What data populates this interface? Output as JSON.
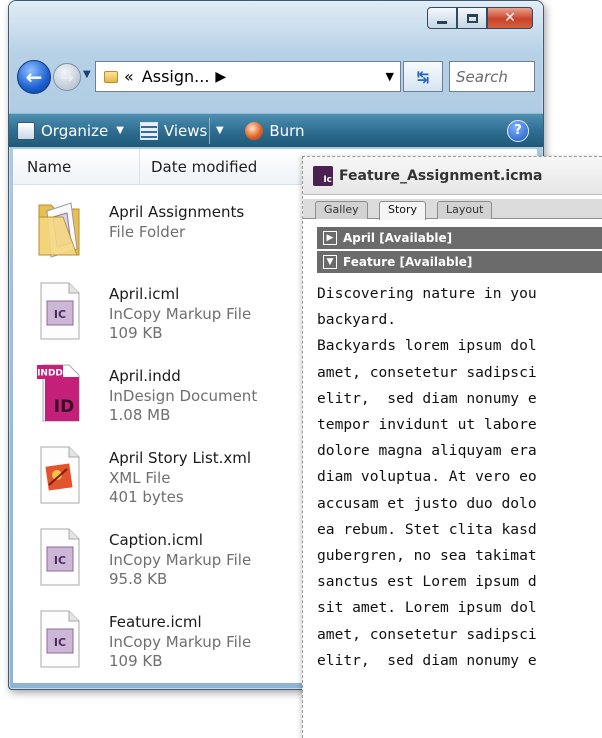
{
  "explorer": {
    "address": {
      "ellipsis": "«",
      "crumb": "Assign...",
      "sep": "▶",
      "dropdown": "▼"
    },
    "search_placeholder": "Search",
    "toolbar": {
      "organize": "Organize",
      "views": "Views",
      "burn": "Burn",
      "help": "?"
    },
    "columns": {
      "name": "Name",
      "date": "Date modified"
    },
    "files": [
      {
        "name": "April Assignments",
        "type": "File Folder",
        "size": "",
        "icon": "folder-icon"
      },
      {
        "name": "April.icml",
        "type": "InCopy Markup File",
        "size": "109 KB",
        "icon": "incopy-file-icon"
      },
      {
        "name": "April.indd",
        "type": "InDesign Document",
        "size": "1.08 MB",
        "icon": "indesign-file-icon"
      },
      {
        "name": "April Story List.xml",
        "type": "XML File",
        "size": "401 bytes",
        "icon": "xml-file-icon"
      },
      {
        "name": "Caption.icml",
        "type": "InCopy Markup File",
        "size": "95.8 KB",
        "icon": "incopy-file-icon"
      },
      {
        "name": "Feature.icml",
        "type": "InCopy Markup File",
        "size": "109 KB",
        "icon": "incopy-file-icon"
      }
    ]
  },
  "incopy": {
    "title": "Feature_Assignment.icma",
    "badge": "Ic",
    "tabs": [
      "Galley",
      "Story",
      "Layout"
    ],
    "stories": [
      {
        "label": "April [Available]",
        "state": "▶"
      },
      {
        "label": "Feature [Available]",
        "state": "▼"
      }
    ],
    "body_lines": [
      "Discovering nature in you",
      "backyard.",
      "Backyards lorem ipsum dol",
      "amet, consetetur sadipsci",
      "elitr,  sed diam nonumy e",
      "tempor invidunt ut labore",
      "dolore magna aliquyam era",
      "diam voluptua. At vero eo",
      "accusam et justo duo dolo",
      "ea rebum. Stet clita kasd",
      "gubergren, no sea takimat",
      "sanctus est Lorem ipsum d",
      "sit amet. Lorem ipsum dol",
      "amet, consetetur sadipsci",
      "elitr,  sed diam nonumy e"
    ]
  },
  "icon_labels": {
    "incopy": "IC",
    "indesign": "ID",
    "indesign_tag": "INDD"
  }
}
